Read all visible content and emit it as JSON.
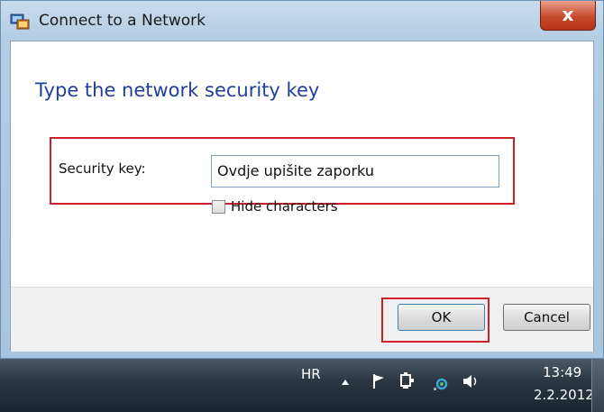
{
  "window": {
    "title": "Connect to a Network",
    "close_label": "x"
  },
  "dialog": {
    "heading": "Type the network security key",
    "security_key_label": "Security key:",
    "security_key_value": "Ovdje upišite zaporku",
    "hide_characters_label": "Hide characters",
    "hide_characters_checked": false,
    "ok_label": "OK",
    "cancel_label": "Cancel"
  },
  "taskbar": {
    "language": "HR",
    "time": "13:49",
    "date": "2.2.2012.",
    "tray_icons": [
      "show-hidden-icons-arrow-icon",
      "action-center-flag-icon",
      "safely-remove-hardware-icon",
      "network-icon",
      "volume-icon"
    ]
  },
  "colors": {
    "heading": "#1f3f9b",
    "highlight_frame": "#d11f2a",
    "close_button": "#c74a2e"
  }
}
